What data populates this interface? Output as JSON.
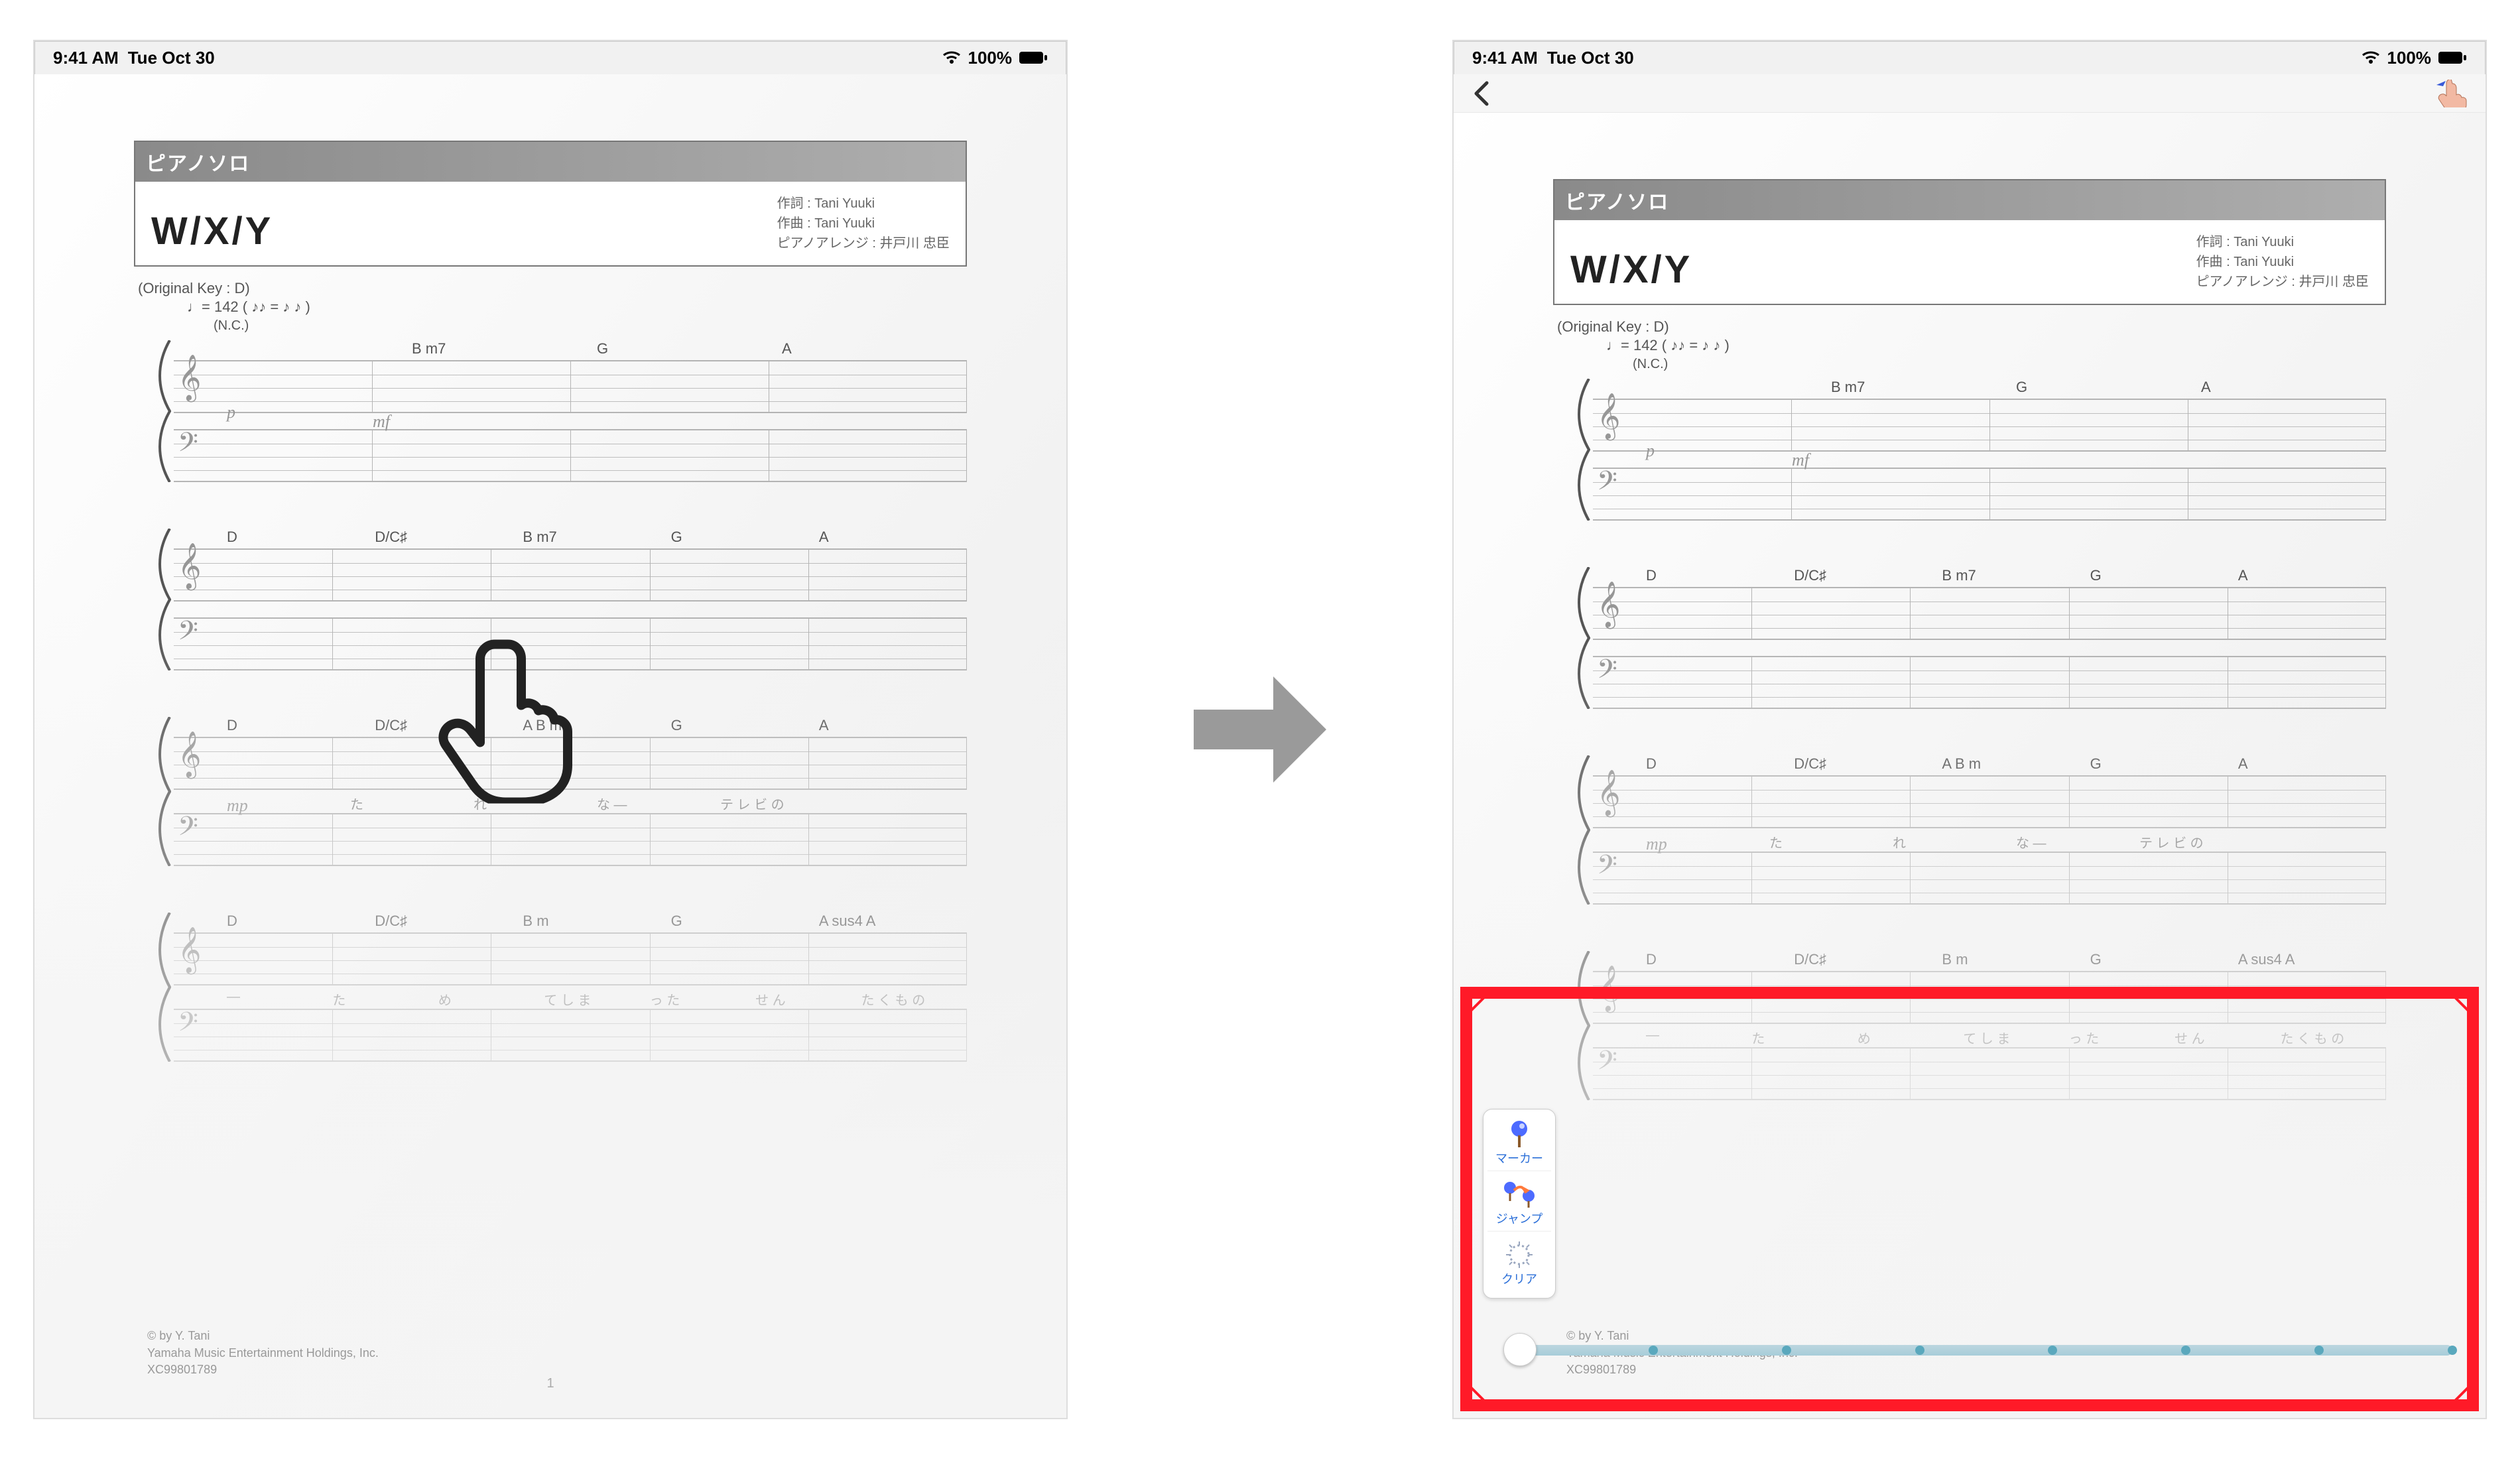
{
  "statusbar": {
    "time": "9:41 AM",
    "date": "Tue Oct 30",
    "battery_text": "100%"
  },
  "sheet": {
    "category_strip": "ピアノソロ",
    "title": "W/X/Y",
    "credits": {
      "lyrics_label": "作詞",
      "lyrics_value": "Tani Yuuki",
      "music_label": "作曲",
      "music_value": "Tani Yuuki",
      "arrange_label": "ピアノアレンジ",
      "arrange_value": "井戸川 忠臣"
    },
    "original_key": "(Original Key : D)",
    "tempo": "♩= 142 ( ♪♪ = ♪ ♪ )",
    "nc": "(N.C.)",
    "system1_chords": [
      "",
      "B m7",
      "G",
      "A"
    ],
    "system1_dyn_p": "p",
    "system1_dyn_mf": "mf",
    "system2_chords": [
      "D",
      "D/C♯",
      "B m7",
      "G",
      "A"
    ],
    "system3_chords": [
      "D",
      "D/C♯",
      "A B m",
      "G",
      "A"
    ],
    "system3_lyrics": [
      "",
      "た",
      "れ",
      "な —",
      "テ レ ビ の",
      ""
    ],
    "system3_dyn_mp": "mp",
    "system4_chords": [
      "D",
      "D/C♯",
      "B m",
      "G",
      "A sus4   A"
    ],
    "system4_lyrics": [
      "—",
      "た",
      "め",
      "て し ま",
      "っ た",
      "せ ん",
      "た く も の"
    ],
    "copyright_line1": "© by Y. Tani",
    "copyright_line2": "Yamaha Music Entertainment Holdings, Inc.",
    "copyright_line3": "XC99801789",
    "page_number": "1"
  },
  "toolbar": {
    "marker_label": "マーカー",
    "jump_label": "ジャンプ",
    "clear_label": "クリア"
  },
  "slider": {
    "stops": 8
  }
}
